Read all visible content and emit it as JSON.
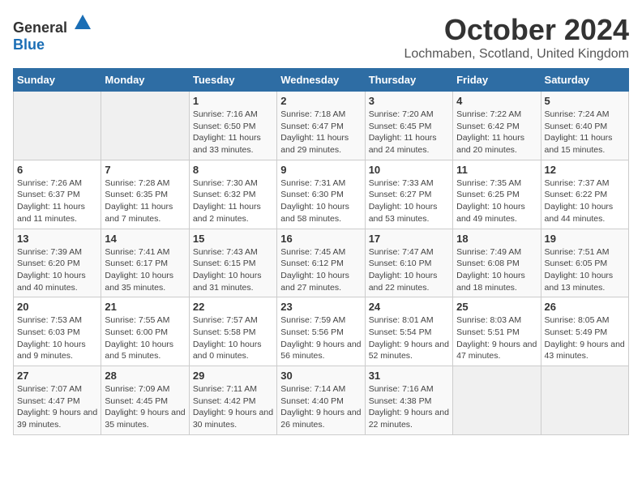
{
  "logo": {
    "general": "General",
    "blue": "Blue"
  },
  "title": "October 2024",
  "location": "Lochmaben, Scotland, United Kingdom",
  "days_of_week": [
    "Sunday",
    "Monday",
    "Tuesday",
    "Wednesday",
    "Thursday",
    "Friday",
    "Saturday"
  ],
  "weeks": [
    [
      {
        "day": "",
        "info": ""
      },
      {
        "day": "",
        "info": ""
      },
      {
        "day": "1",
        "info": "Sunrise: 7:16 AM\nSunset: 6:50 PM\nDaylight: 11 hours and 33 minutes."
      },
      {
        "day": "2",
        "info": "Sunrise: 7:18 AM\nSunset: 6:47 PM\nDaylight: 11 hours and 29 minutes."
      },
      {
        "day": "3",
        "info": "Sunrise: 7:20 AM\nSunset: 6:45 PM\nDaylight: 11 hours and 24 minutes."
      },
      {
        "day": "4",
        "info": "Sunrise: 7:22 AM\nSunset: 6:42 PM\nDaylight: 11 hours and 20 minutes."
      },
      {
        "day": "5",
        "info": "Sunrise: 7:24 AM\nSunset: 6:40 PM\nDaylight: 11 hours and 15 minutes."
      }
    ],
    [
      {
        "day": "6",
        "info": "Sunrise: 7:26 AM\nSunset: 6:37 PM\nDaylight: 11 hours and 11 minutes."
      },
      {
        "day": "7",
        "info": "Sunrise: 7:28 AM\nSunset: 6:35 PM\nDaylight: 11 hours and 7 minutes."
      },
      {
        "day": "8",
        "info": "Sunrise: 7:30 AM\nSunset: 6:32 PM\nDaylight: 11 hours and 2 minutes."
      },
      {
        "day": "9",
        "info": "Sunrise: 7:31 AM\nSunset: 6:30 PM\nDaylight: 10 hours and 58 minutes."
      },
      {
        "day": "10",
        "info": "Sunrise: 7:33 AM\nSunset: 6:27 PM\nDaylight: 10 hours and 53 minutes."
      },
      {
        "day": "11",
        "info": "Sunrise: 7:35 AM\nSunset: 6:25 PM\nDaylight: 10 hours and 49 minutes."
      },
      {
        "day": "12",
        "info": "Sunrise: 7:37 AM\nSunset: 6:22 PM\nDaylight: 10 hours and 44 minutes."
      }
    ],
    [
      {
        "day": "13",
        "info": "Sunrise: 7:39 AM\nSunset: 6:20 PM\nDaylight: 10 hours and 40 minutes."
      },
      {
        "day": "14",
        "info": "Sunrise: 7:41 AM\nSunset: 6:17 PM\nDaylight: 10 hours and 35 minutes."
      },
      {
        "day": "15",
        "info": "Sunrise: 7:43 AM\nSunset: 6:15 PM\nDaylight: 10 hours and 31 minutes."
      },
      {
        "day": "16",
        "info": "Sunrise: 7:45 AM\nSunset: 6:12 PM\nDaylight: 10 hours and 27 minutes."
      },
      {
        "day": "17",
        "info": "Sunrise: 7:47 AM\nSunset: 6:10 PM\nDaylight: 10 hours and 22 minutes."
      },
      {
        "day": "18",
        "info": "Sunrise: 7:49 AM\nSunset: 6:08 PM\nDaylight: 10 hours and 18 minutes."
      },
      {
        "day": "19",
        "info": "Sunrise: 7:51 AM\nSunset: 6:05 PM\nDaylight: 10 hours and 13 minutes."
      }
    ],
    [
      {
        "day": "20",
        "info": "Sunrise: 7:53 AM\nSunset: 6:03 PM\nDaylight: 10 hours and 9 minutes."
      },
      {
        "day": "21",
        "info": "Sunrise: 7:55 AM\nSunset: 6:00 PM\nDaylight: 10 hours and 5 minutes."
      },
      {
        "day": "22",
        "info": "Sunrise: 7:57 AM\nSunset: 5:58 PM\nDaylight: 10 hours and 0 minutes."
      },
      {
        "day": "23",
        "info": "Sunrise: 7:59 AM\nSunset: 5:56 PM\nDaylight: 9 hours and 56 minutes."
      },
      {
        "day": "24",
        "info": "Sunrise: 8:01 AM\nSunset: 5:54 PM\nDaylight: 9 hours and 52 minutes."
      },
      {
        "day": "25",
        "info": "Sunrise: 8:03 AM\nSunset: 5:51 PM\nDaylight: 9 hours and 47 minutes."
      },
      {
        "day": "26",
        "info": "Sunrise: 8:05 AM\nSunset: 5:49 PM\nDaylight: 9 hours and 43 minutes."
      }
    ],
    [
      {
        "day": "27",
        "info": "Sunrise: 7:07 AM\nSunset: 4:47 PM\nDaylight: 9 hours and 39 minutes."
      },
      {
        "day": "28",
        "info": "Sunrise: 7:09 AM\nSunset: 4:45 PM\nDaylight: 9 hours and 35 minutes."
      },
      {
        "day": "29",
        "info": "Sunrise: 7:11 AM\nSunset: 4:42 PM\nDaylight: 9 hours and 30 minutes."
      },
      {
        "day": "30",
        "info": "Sunrise: 7:14 AM\nSunset: 4:40 PM\nDaylight: 9 hours and 26 minutes."
      },
      {
        "day": "31",
        "info": "Sunrise: 7:16 AM\nSunset: 4:38 PM\nDaylight: 9 hours and 22 minutes."
      },
      {
        "day": "",
        "info": ""
      },
      {
        "day": "",
        "info": ""
      }
    ]
  ]
}
